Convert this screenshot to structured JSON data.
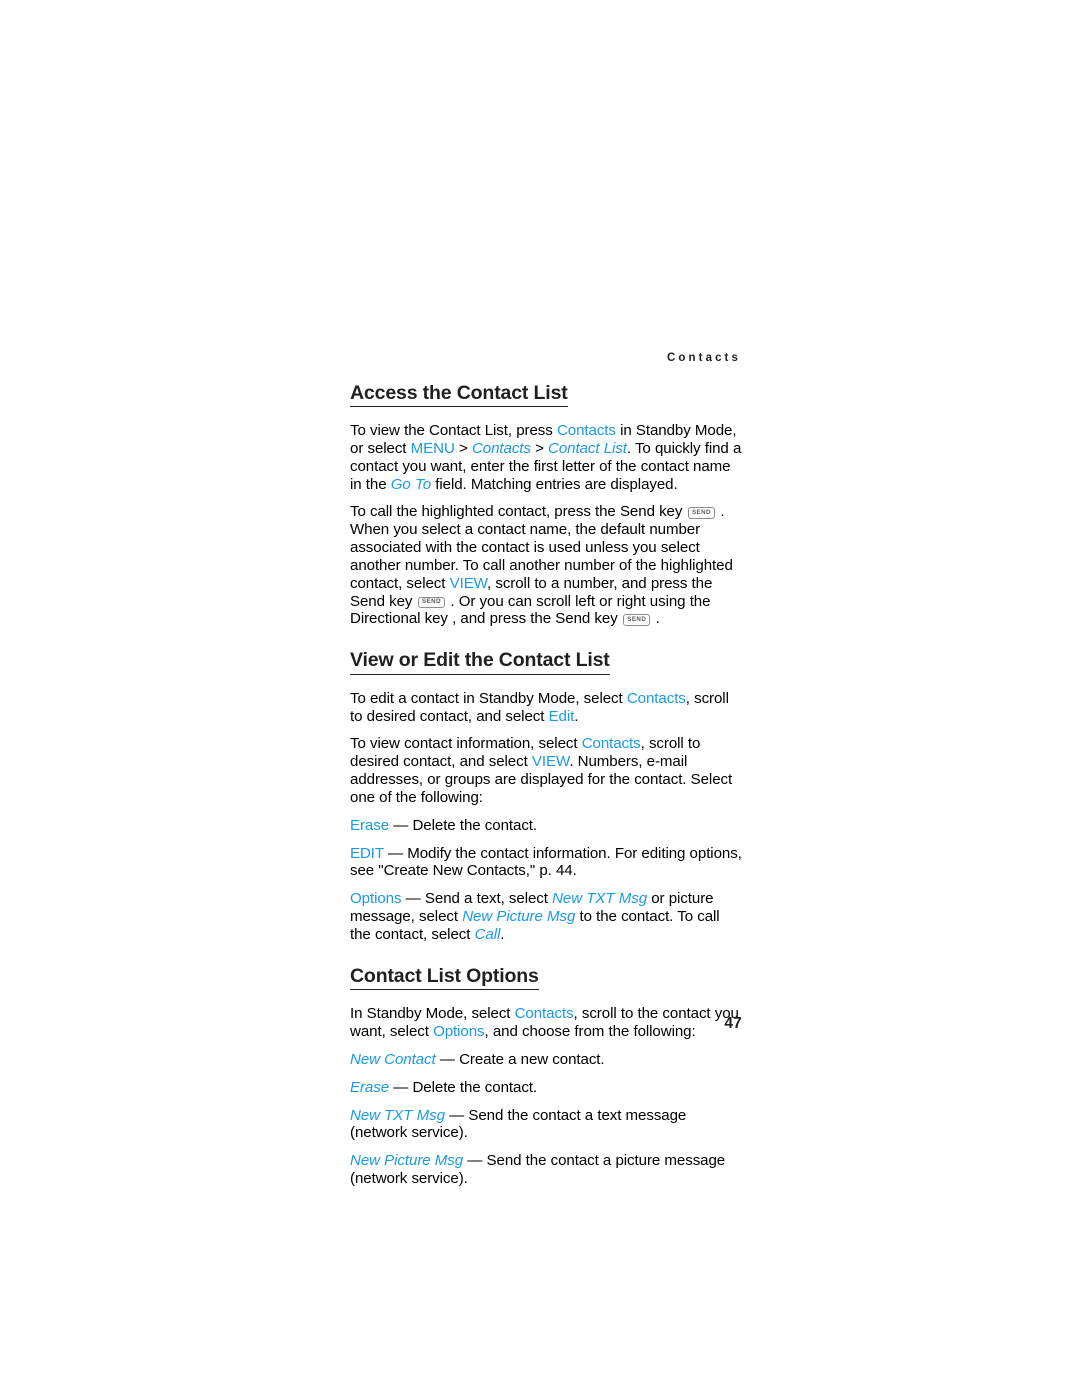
{
  "page": {
    "running_head": "Contacts",
    "folio": "47",
    "accent_blue": "#1b9ae1",
    "text_color": "#000000",
    "heading_color": "#231f20",
    "background": "#ffffff"
  },
  "sections": [
    {
      "heading": "Access the Contact List",
      "paragraphs": [
        {
          "id": "p1",
          "runs": [
            {
              "text": "To view the Contact List, press ",
              "style": "plain"
            },
            {
              "text": "Contacts",
              "style": "blue"
            },
            {
              "text": " in Standby Mode, or select ",
              "style": "plain"
            },
            {
              "text": "MENU",
              "style": "blue"
            },
            {
              "text": " > ",
              "style": "plain"
            },
            {
              "text": "Contacts",
              "style": "blue-italic"
            },
            {
              "text": " > ",
              "style": "plain"
            },
            {
              "text": "Contact List",
              "style": "blue-italic"
            },
            {
              "text": ". To quickly find a contact you want, enter the first letter of the contact name in the ",
              "style": "plain"
            },
            {
              "text": "Go To",
              "style": "blue-italic"
            },
            {
              "text": " field. Matching entries are displayed.",
              "style": "plain"
            }
          ]
        },
        {
          "id": "p2",
          "runs": [
            {
              "text": "To call the highlighted contact, press the Send key ",
              "style": "plain"
            },
            {
              "text": "SEND",
              "style": "key"
            },
            {
              "text": " . When you select a contact name, the default number associated with the contact is used unless you select another number. To call another number of the highlighted contact, select ",
              "style": "plain"
            },
            {
              "text": "VIEW",
              "style": "blue"
            },
            {
              "text": ", scroll to a number, and press the Send key ",
              "style": "plain"
            },
            {
              "text": "SEND",
              "style": "key"
            },
            {
              "text": " . Or you can scroll left or right using the Directional key , and press the Send key ",
              "style": "plain"
            },
            {
              "text": "SEND",
              "style": "key"
            },
            {
              "text": " .",
              "style": "plain"
            }
          ]
        }
      ]
    },
    {
      "heading": "View or Edit the Contact List",
      "paragraphs": [
        {
          "id": "p3",
          "runs": [
            {
              "text": "To edit a contact in Standby Mode, select ",
              "style": "plain"
            },
            {
              "text": "Contacts",
              "style": "blue"
            },
            {
              "text": ", scroll to desired contact, and select ",
              "style": "plain"
            },
            {
              "text": "Edit",
              "style": "blue"
            },
            {
              "text": ".",
              "style": "plain"
            }
          ]
        },
        {
          "id": "p4",
          "runs": [
            {
              "text": "To view contact information, select ",
              "style": "plain"
            },
            {
              "text": "Contacts",
              "style": "blue"
            },
            {
              "text": ", scroll to desired contact, and select ",
              "style": "plain"
            },
            {
              "text": "VIEW",
              "style": "blue"
            },
            {
              "text": ". Numbers, e-mail addresses, or groups are displayed for the contact. Select one of the following:",
              "style": "plain"
            }
          ]
        },
        {
          "id": "p5",
          "runs": [
            {
              "text": "Erase",
              "style": "blue"
            },
            {
              "text": " — Delete the contact.",
              "style": "plain"
            }
          ]
        },
        {
          "id": "p6",
          "runs": [
            {
              "text": "EDIT",
              "style": "blue"
            },
            {
              "text": " — Modify the contact information. For editing options, see \"Create New Contacts,\" p. 44.",
              "style": "plain"
            }
          ]
        },
        {
          "id": "p7",
          "runs": [
            {
              "text": "Options",
              "style": "blue"
            },
            {
              "text": " — Send a text, select ",
              "style": "plain"
            },
            {
              "text": "New TXT Msg",
              "style": "blue-italic"
            },
            {
              "text": " or picture message, select ",
              "style": "plain"
            },
            {
              "text": "New Picture Msg",
              "style": "blue-italic"
            },
            {
              "text": " to the contact. To call the contact, select ",
              "style": "plain"
            },
            {
              "text": "Call",
              "style": "blue-italic"
            },
            {
              "text": ".",
              "style": "plain"
            }
          ]
        }
      ]
    },
    {
      "heading": "Contact List Options",
      "paragraphs": [
        {
          "id": "p8",
          "runs": [
            {
              "text": "In Standby Mode, select ",
              "style": "plain"
            },
            {
              "text": "Contacts",
              "style": "blue"
            },
            {
              "text": ", scroll to the contact you want, select ",
              "style": "plain"
            },
            {
              "text": "Options",
              "style": "blue"
            },
            {
              "text": ", and choose from the following:",
              "style": "plain"
            }
          ]
        },
        {
          "id": "p9",
          "runs": [
            {
              "text": "New Contact",
              "style": "blue-italic"
            },
            {
              "text": " — Create a new contact.",
              "style": "plain"
            }
          ]
        },
        {
          "id": "p10",
          "runs": [
            {
              "text": "Erase",
              "style": "blue-italic"
            },
            {
              "text": " — Delete the contact.",
              "style": "plain"
            }
          ]
        },
        {
          "id": "p11",
          "runs": [
            {
              "text": "New TXT Msg",
              "style": "blue-italic"
            },
            {
              "text": " — Send the contact a text message (network service).",
              "style": "plain"
            }
          ]
        },
        {
          "id": "p12",
          "runs": [
            {
              "text": "New Picture Msg",
              "style": "blue-italic"
            },
            {
              "text": " — Send the contact a picture message (network service).",
              "style": "plain"
            }
          ]
        }
      ]
    }
  ]
}
